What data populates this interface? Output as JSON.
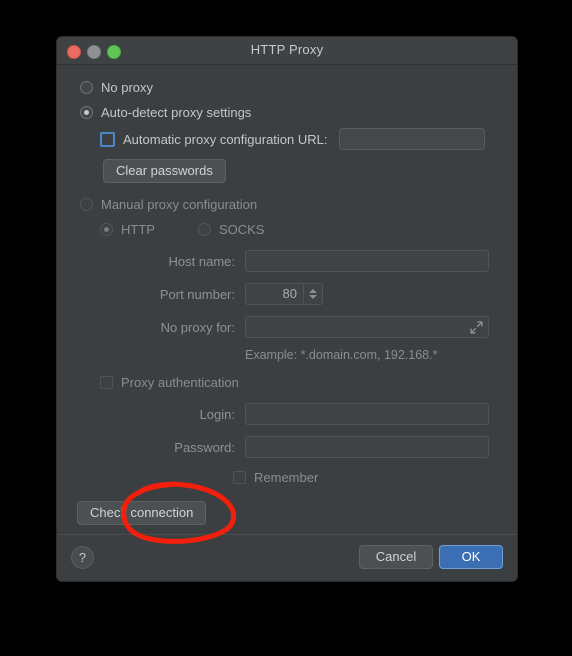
{
  "window": {
    "title": "HTTP Proxy",
    "traffic_lights": [
      "close-button",
      "minimize-button",
      "maximize-button"
    ]
  },
  "options": {
    "no_proxy": {
      "label": "No proxy",
      "selected": false
    },
    "auto_detect": {
      "label": "Auto-detect proxy settings",
      "selected": true
    },
    "auto_config": {
      "label": "Automatic proxy configuration URL:",
      "checked": false,
      "value": "",
      "focused": true
    },
    "clear_passwords_label": "Clear passwords",
    "manual": {
      "label": "Manual proxy configuration",
      "selected": false
    },
    "protocol": {
      "http": {
        "label": "HTTP",
        "selected": true
      },
      "socks": {
        "label": "SOCKS",
        "selected": false
      }
    }
  },
  "fields": {
    "host_name": {
      "label": "Host name:",
      "value": ""
    },
    "port_number": {
      "label": "Port number:",
      "value": "80"
    },
    "no_proxy_for": {
      "label": "No proxy for:",
      "value": "",
      "expand_icon": "expand-arrow-icon"
    },
    "example_hint": "Example: *.domain.com, 192.168.*",
    "proxy_authentication": {
      "label": "Proxy authentication",
      "checked": false
    },
    "login": {
      "label": "Login:",
      "value": ""
    },
    "password": {
      "label": "Password:",
      "value": ""
    },
    "remember": {
      "label": "Remember",
      "checked": false
    }
  },
  "actions": {
    "check_connection_label": "Check connection",
    "help_label": "?",
    "cancel_label": "Cancel",
    "ok_label": "OK"
  },
  "colors": {
    "dialog_background": "#3c3f41",
    "titlebar": "#3f4244",
    "primary_button": "#3c6eb4",
    "focus_ring": "#4a88c7",
    "annotation_stroke": "#f21f0c",
    "traffic_close": "#ec6a5f",
    "traffic_minimize": "#8f9193",
    "traffic_maximize": "#61c555"
  },
  "annotation": {
    "shape": "hand-drawn-ellipse",
    "target": "check-connection-button",
    "color": "#f21f0c"
  }
}
